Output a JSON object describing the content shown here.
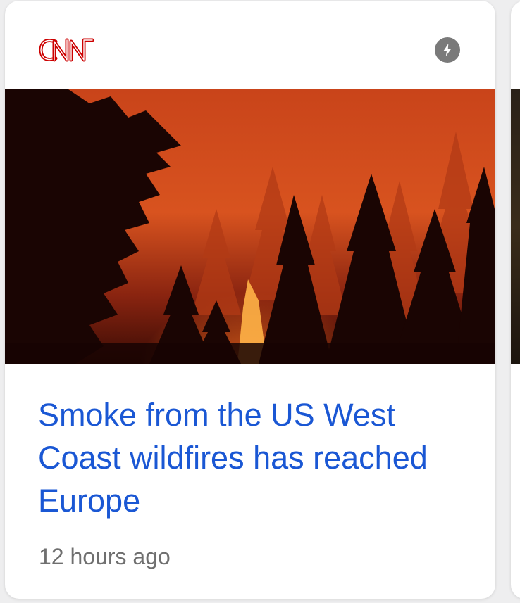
{
  "card": {
    "source": "CNN",
    "amp_icon": "lightning-bolt-icon",
    "image_alt": "wildfire-forest-image",
    "headline": "Smoke from the US West Coast wildfires has reached Europe",
    "timestamp": "12 hours ago"
  },
  "colors": {
    "headline": "#1a57d4",
    "timestamp": "#6f6f6f",
    "logo_red": "#cc0000",
    "amp_badge": "#7a7a7a",
    "fire_orange": "#e8641c"
  }
}
